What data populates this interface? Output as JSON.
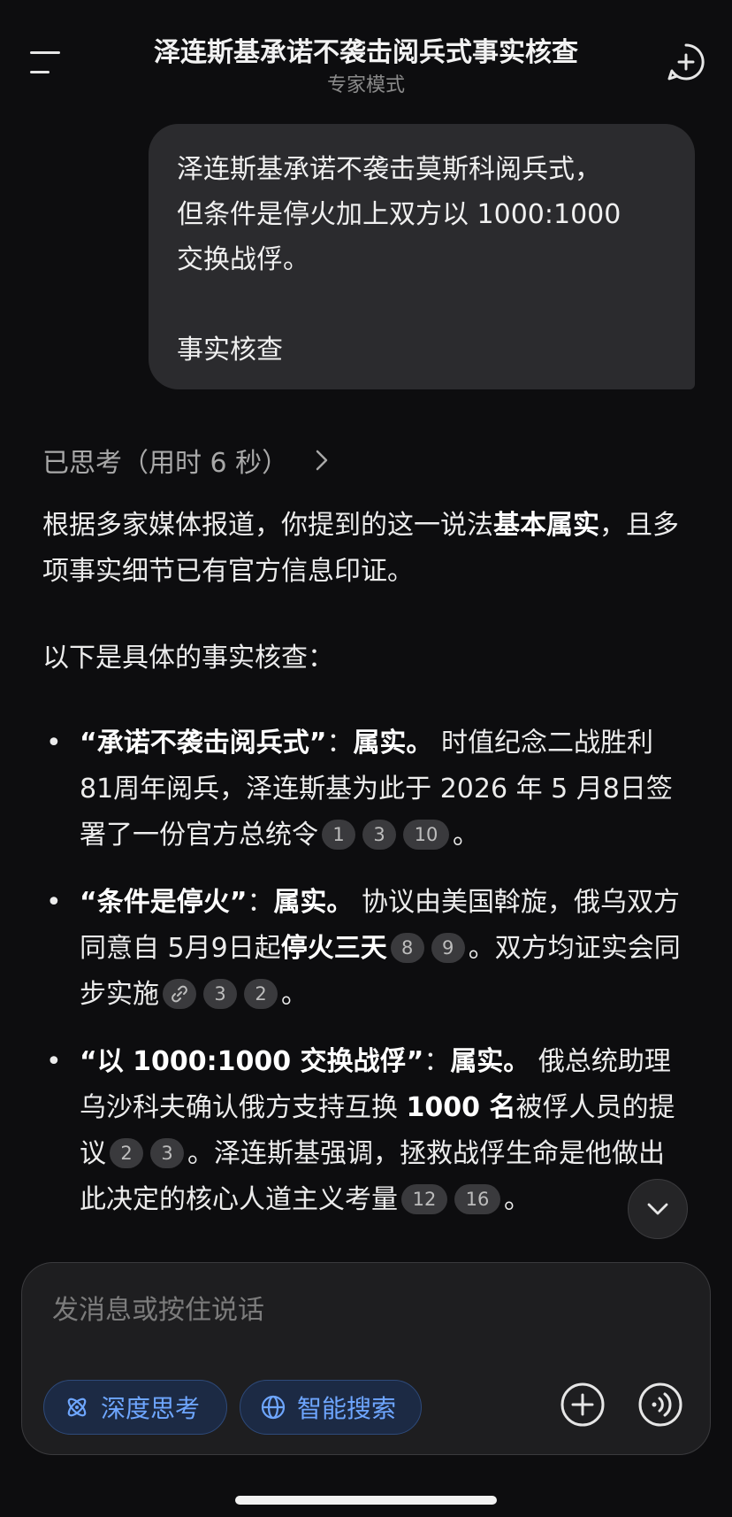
{
  "header": {
    "title": "泽连斯基承诺不袭击阅兵式事实核查",
    "subtitle": "专家模式"
  },
  "user_message": {
    "lines": [
      "泽连斯基承诺不袭击莫斯科阅兵式，",
      "但条件是停火加上双方以 1000:1000",
      "交换战俘。"
    ],
    "tail": "事实核查"
  },
  "thinking": {
    "label": "已思考（用时 6 秒）"
  },
  "answer": {
    "intro_a": "根据多家媒体报道，你提到的这一说法",
    "intro_bold": "基本属实",
    "intro_b": "，且多项事实细节已有官方信息印证。",
    "section": "以下是具体的事实核查：",
    "points": [
      {
        "title": "“承诺不袭击阅兵式”",
        "colon": "：",
        "verdict": "属实。",
        "text": " 时值纪念二战胜利 81周年阅兵，泽连斯基为此于 2026 年 5 月8日签署了一份官方总统令",
        "cites": [
          "1",
          "3",
          "10"
        ],
        "end": "。"
      },
      {
        "title": "“条件是停火”",
        "colon": "：",
        "verdict": "属实。",
        "text_a": " 协议由美国斡旋，俄乌双方同意自 5月9日起",
        "text_bold": "停火三天",
        "cites_a": [
          "8",
          "9"
        ],
        "text_b": "。双方均证实会同步实施",
        "cites_b": [
          "3",
          "2"
        ],
        "end": "。"
      },
      {
        "title": "“以 1000:1000 交换战俘”",
        "colon": "：",
        "verdict": "属实。",
        "text_a": " 俄总统助理乌沙科夫确认俄方支持互换 ",
        "text_bold": "1000 名",
        "text_b": "被俘人员的提议",
        "cites_a": [
          "2",
          "3"
        ],
        "text_c": "。泽连斯基强调，拯救战俘生命是他做出此决定的核心人道主义考量",
        "cites_b": [
          "12",
          "16"
        ],
        "end": "。"
      }
    ]
  },
  "composer": {
    "placeholder": "发消息或按住说话",
    "deep_think": "深度思考",
    "smart_search": "智能搜索"
  },
  "colors": {
    "accent": "#6ea6ff",
    "background": "#0d0d0f",
    "bubble": "#2b2b2e"
  }
}
